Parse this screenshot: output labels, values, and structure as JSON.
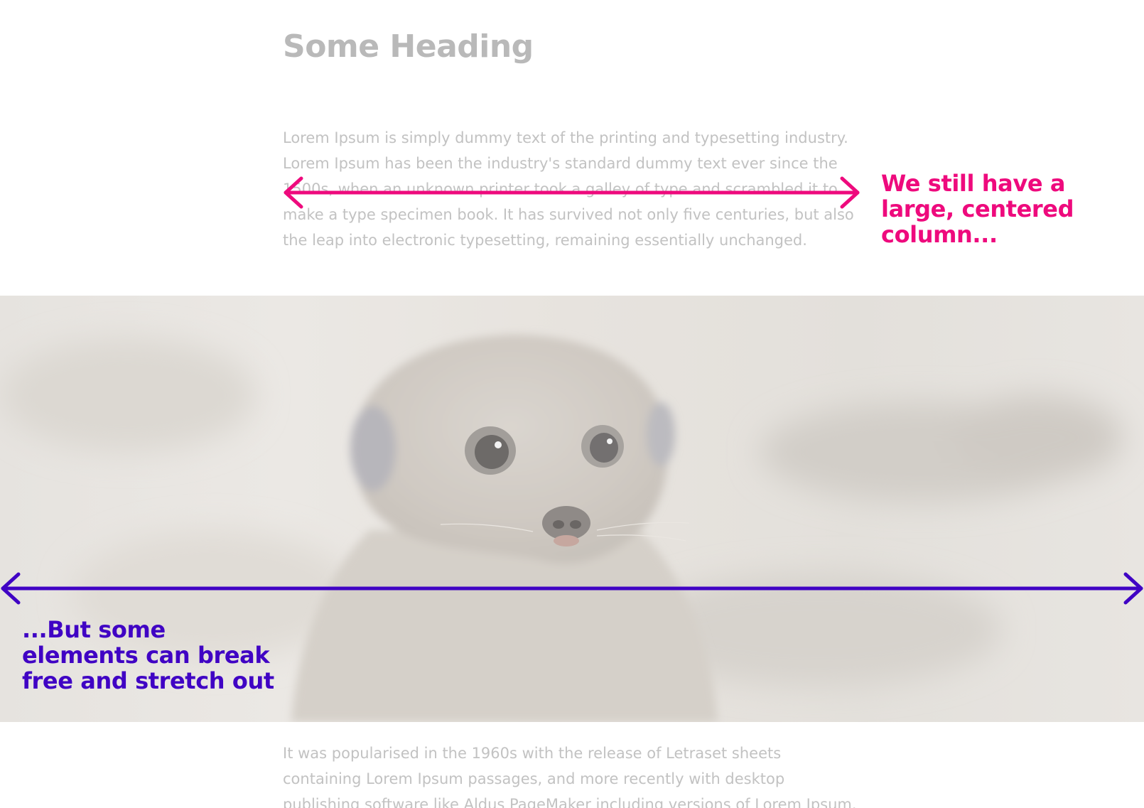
{
  "article": {
    "heading": "Some Heading",
    "paragraph_1": "Lorem Ipsum is simply dummy text of the printing and typesetting industry. Lorem Ipsum has been the industry's standard dummy text ever since the 1500s, when an unknown printer took a galley of type and scrambled it to make a type specimen book. It has survived not only five centuries, but also the leap into electronic typesetting, remaining essentially unchanged.",
    "paragraph_2": "It was popularised in the 1960s with the release of Letraset sheets containing Lorem Ipsum passages, and more recently with desktop publishing software like Aldus PageMaker including versions of Lorem Ipsum."
  },
  "hero_image": {
    "subject": "meerkat"
  },
  "annotations": {
    "column_callout": "We still have a large, centered column...",
    "fullwidth_callout": "...But some elements can break free and stretch out",
    "column_arrow_color": "#ee0a7d",
    "fullwidth_arrow_color": "#4003c4"
  }
}
